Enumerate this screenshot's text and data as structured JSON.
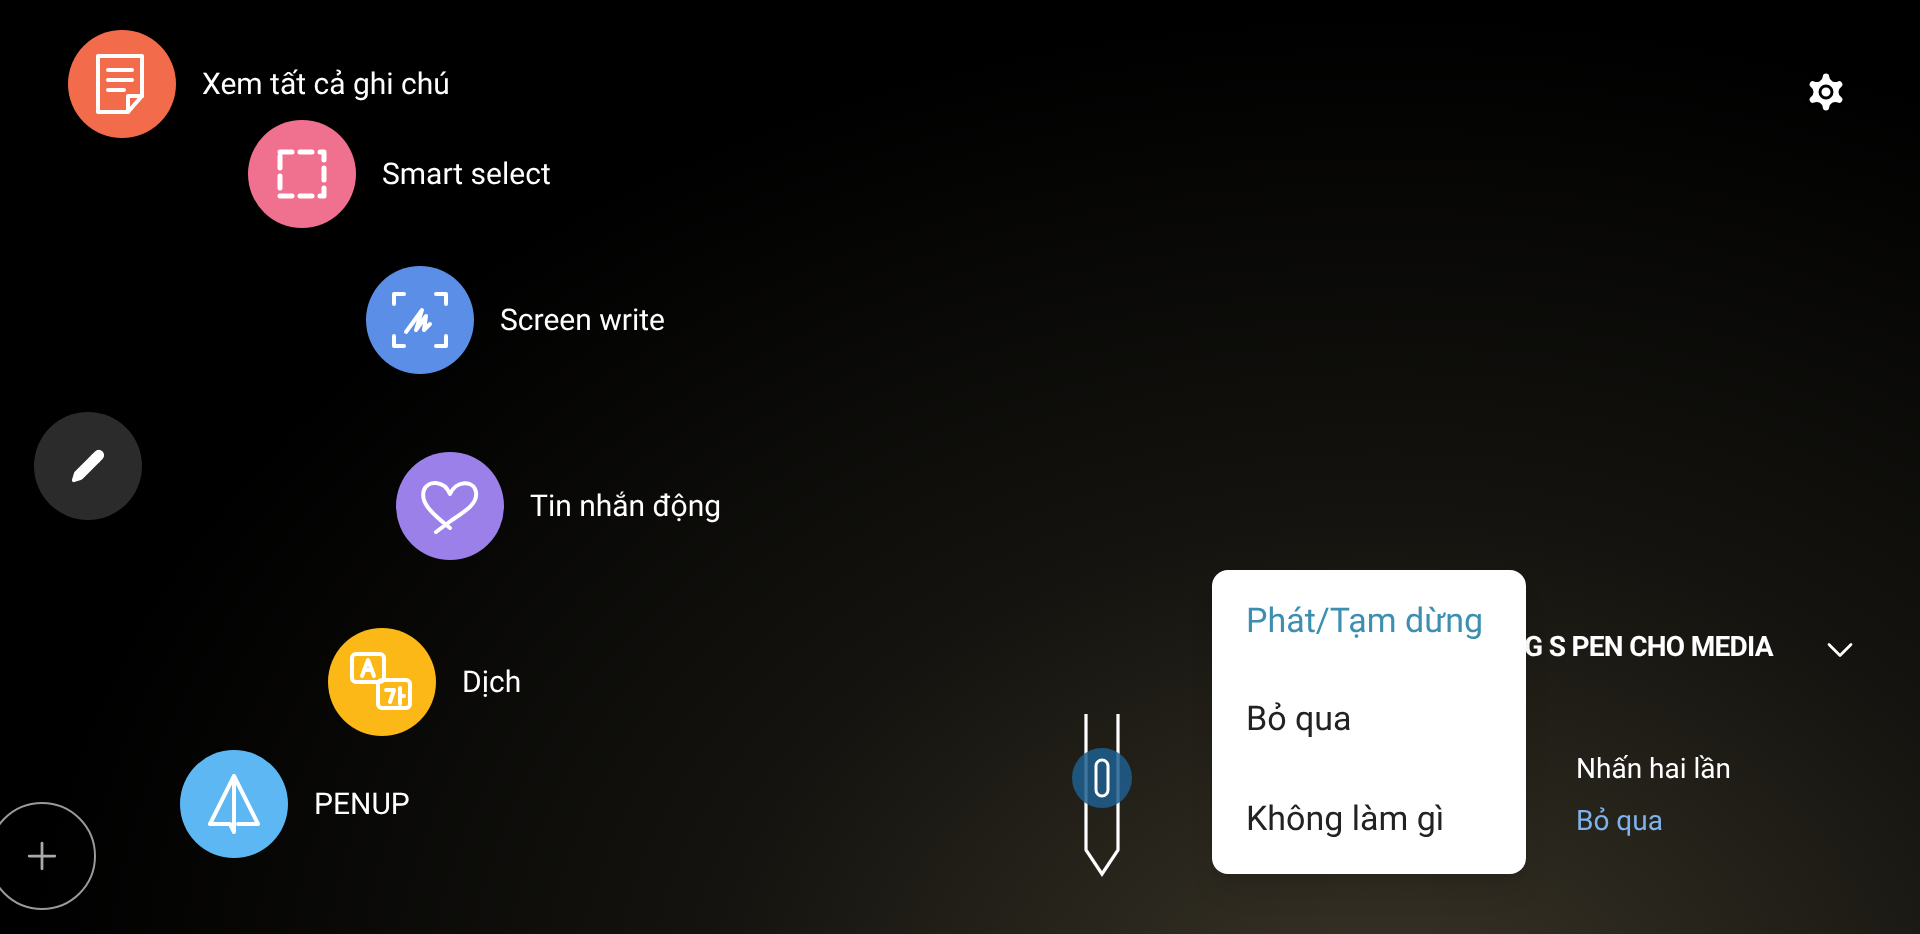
{
  "air_command": {
    "items": [
      {
        "kind": "notes",
        "label": "Xem tất cả ghi chú",
        "color": "#f26b4b"
      },
      {
        "kind": "smart_select",
        "label": "Smart select",
        "color": "#f0708f"
      },
      {
        "kind": "screen_write",
        "label": "Screen write",
        "color": "#5b8ee6"
      },
      {
        "kind": "live_message",
        "label": "Tin nhắn động",
        "color": "#9b80ea"
      },
      {
        "kind": "translate",
        "label": "Dịch",
        "color": "#fbb817"
      },
      {
        "kind": "penup",
        "label": "PENUP",
        "color": "#5db7f2"
      }
    ]
  },
  "media_section": {
    "title": "G S PEN CHO MEDIA",
    "row": {
      "label": "Nhấn hai lần",
      "value": "Bỏ qua"
    }
  },
  "dropdown": {
    "options": [
      {
        "label": "Phát/Tạm dừng",
        "selected": true
      },
      {
        "label": "Bỏ qua",
        "selected": false
      },
      {
        "label": "Không làm gì",
        "selected": false
      }
    ]
  }
}
